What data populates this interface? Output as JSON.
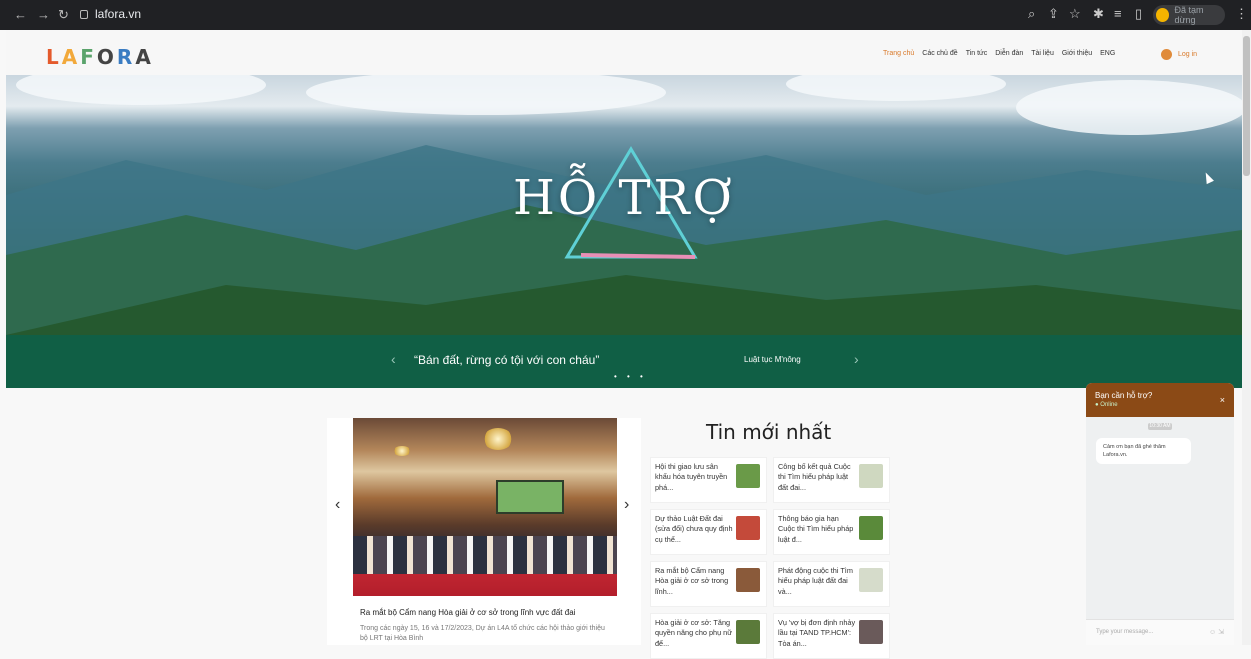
{
  "browser": {
    "url": "lafora.vn",
    "profile_status": "Đã tạm dừng",
    "icons": [
      "back-icon",
      "forward-icon",
      "reload-icon",
      "lock-icon",
      "zoom-icon",
      "share-icon",
      "star-icon",
      "extension-icon",
      "playlist-icon",
      "sidebar-icon",
      "menu-icon"
    ]
  },
  "site": {
    "logo": "LAFORA",
    "nav": [
      "Trang chủ",
      "Các chủ đề",
      "Tin tức",
      "Diễn đàn",
      "Tài liệu",
      "Giới thiệu",
      "ENG"
    ],
    "login": "Log in",
    "accent": "#d97a2b"
  },
  "hero": {
    "title": "HỖ TRỢ",
    "quote": "“Bán đất, rừng có tội với con cháu”",
    "source": "Luật tục M'nông",
    "prev": "‹",
    "next": "›",
    "dots": "• • •"
  },
  "featured": {
    "title": "Ra mắt bộ Cẩm nang Hòa giải ở cơ sở trong lĩnh vực đất đai",
    "desc": "Trong các ngày 15, 16 và 17/2/2023, Dự án L4A tổ chức các hội thảo giới thiệu bộ LRT tại Hòa Bình",
    "prev": "‹",
    "next": "›"
  },
  "news": {
    "heading": "Tin mới nhất",
    "items": [
      {
        "title": "Hội thi giao lưu sân khấu hóa tuyên truyền phá...",
        "thumb": "#6a9a48"
      },
      {
        "title": "Công bố kết quả Cuộc thi Tìm hiểu pháp luật đất đai...",
        "thumb": "#cfd8c0"
      },
      {
        "title": "Dự thảo Luật Đất đai (sửa đổi) chưa quy định cụ thể...",
        "thumb": "#c44a3a"
      },
      {
        "title": "Thông báo gia hạn Cuộc thi Tìm hiểu pháp luật đ...",
        "thumb": "#5a8a3a"
      },
      {
        "title": "Ra mắt bộ Cẩm nang Hòa giải ở cơ sở trong lĩnh...",
        "thumb": "#8a5a3a"
      },
      {
        "title": "Phát động cuộc thi Tìm hiểu pháp luật đất đai và...",
        "thumb": "#d6dccb"
      },
      {
        "title": "Hòa giải ở cơ sở: Tăng quyền năng cho phụ nữ để...",
        "thumb": "#5b7a3a"
      },
      {
        "title": "Vụ 'vợ bị đơn định nhảy lầu tại TAND TP.HCM': Tòa án...",
        "thumb": "#6a5a5a"
      }
    ]
  },
  "chat": {
    "title": "Bạn cần hỗ trợ?",
    "status": "Online",
    "time": "10:30 AM",
    "message": "Cảm ơn bạn đã ghé thăm Lafora.vn.",
    "input_placeholder": "Type your message...",
    "close": "×"
  }
}
